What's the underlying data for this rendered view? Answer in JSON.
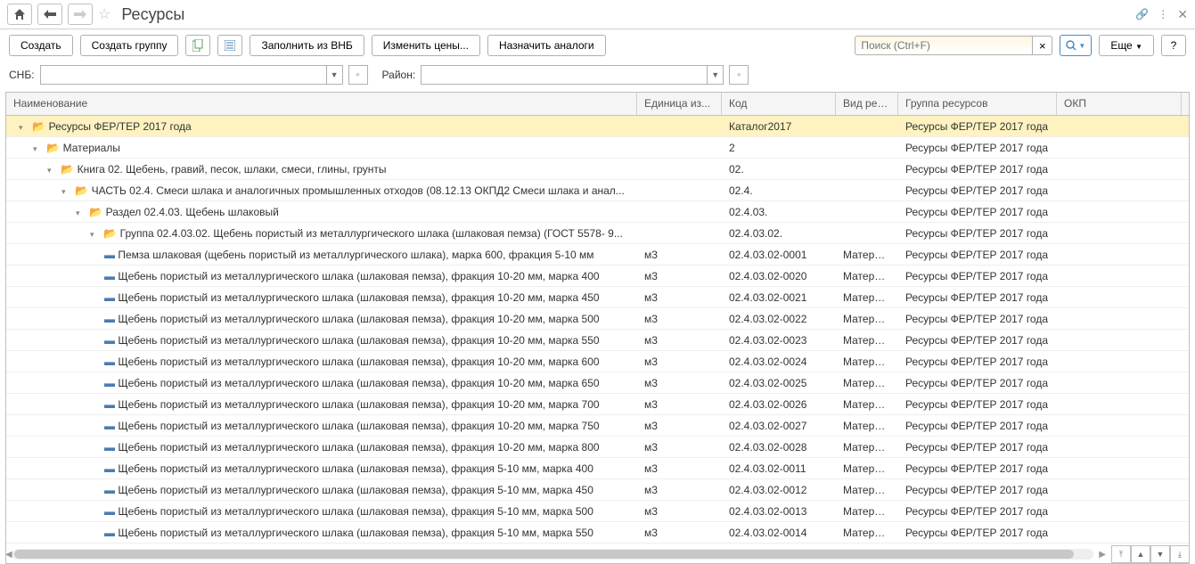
{
  "header": {
    "title": "Ресурсы"
  },
  "toolbar": {
    "create": "Создать",
    "create_group": "Создать группу",
    "fill": "Заполнить из ВНБ",
    "change": "Изменить цены...",
    "analogs": "Назначить аналоги",
    "search_placeholder": "Поиск (Ctrl+F)",
    "more": "Еще"
  },
  "filters": {
    "snb_label": "СНБ:",
    "region_label": "Район:"
  },
  "columns": {
    "name": "Наименование",
    "unit": "Единица из...",
    "code": "Код",
    "type": "Вид ресу...",
    "group": "Группа ресурсов",
    "okp": "ОКП"
  },
  "rows": [
    {
      "level": 0,
      "folder": true,
      "expanded": true,
      "selected": true,
      "name": "Ресурсы ФЕР/ТЕР 2017 года",
      "unit": "",
      "code": "Каталог2017",
      "type": "",
      "group": "Ресурсы ФЕР/ТЕР 2017 года"
    },
    {
      "level": 1,
      "folder": true,
      "expanded": true,
      "name": "Материалы",
      "unit": "",
      "code": "2",
      "type": "",
      "group": "Ресурсы ФЕР/ТЕР 2017 года"
    },
    {
      "level": 2,
      "folder": true,
      "expanded": true,
      "name": "Книга 02. Щебень, гравий, песок, шлаки, смеси, глины, грунты",
      "unit": "",
      "code": "02.",
      "type": "",
      "group": "Ресурсы ФЕР/ТЕР 2017 года"
    },
    {
      "level": 3,
      "folder": true,
      "expanded": true,
      "name": "ЧАСТЬ 02.4. Смеси шлака и аналогичных промышленных отходов (08.12.13 ОКПД2 Смеси шлака и анал...",
      "unit": "",
      "code": "02.4.",
      "type": "",
      "group": "Ресурсы ФЕР/ТЕР 2017 года"
    },
    {
      "level": 4,
      "folder": true,
      "expanded": true,
      "name": "Раздел 02.4.03. Щебень шлаковый",
      "unit": "",
      "code": "02.4.03.",
      "type": "",
      "group": "Ресурсы ФЕР/ТЕР 2017 года"
    },
    {
      "level": 5,
      "folder": true,
      "expanded": true,
      "name": "Группа 02.4.03.02. Щебень пористый из металлургического шлака (шлаковая пемза) (ГОСТ 5578- 9...",
      "unit": "",
      "code": "02.4.03.02.",
      "type": "",
      "group": "Ресурсы ФЕР/ТЕР 2017 года"
    },
    {
      "level": 6,
      "folder": false,
      "name": "Пемза шлаковая (щебень пористый из металлургического шлака), марка 600, фракция 5-10 мм",
      "unit": "м3",
      "code": "02.4.03.02-0001",
      "type": "Материа...",
      "group": "Ресурсы ФЕР/ТЕР 2017 года"
    },
    {
      "level": 6,
      "folder": false,
      "name": "Щебень пористый из металлургического шлака (шлаковая пемза), фракция 10-20 мм, марка 400",
      "unit": "м3",
      "code": "02.4.03.02-0020",
      "type": "Материа...",
      "group": "Ресурсы ФЕР/ТЕР 2017 года"
    },
    {
      "level": 6,
      "folder": false,
      "name": "Щебень пористый из металлургического шлака (шлаковая пемза), фракция 10-20 мм, марка 450",
      "unit": "м3",
      "code": "02.4.03.02-0021",
      "type": "Материа...",
      "group": "Ресурсы ФЕР/ТЕР 2017 года"
    },
    {
      "level": 6,
      "folder": false,
      "name": "Щебень пористый из металлургического шлака (шлаковая пемза), фракция 10-20 мм, марка 500",
      "unit": "м3",
      "code": "02.4.03.02-0022",
      "type": "Материа...",
      "group": "Ресурсы ФЕР/ТЕР 2017 года"
    },
    {
      "level": 6,
      "folder": false,
      "name": "Щебень пористый из металлургического шлака (шлаковая пемза), фракция 10-20 мм, марка 550",
      "unit": "м3",
      "code": "02.4.03.02-0023",
      "type": "Материа...",
      "group": "Ресурсы ФЕР/ТЕР 2017 года"
    },
    {
      "level": 6,
      "folder": false,
      "name": "Щебень пористый из металлургического шлака (шлаковая пемза), фракция 10-20 мм, марка 600",
      "unit": "м3",
      "code": "02.4.03.02-0024",
      "type": "Материа...",
      "group": "Ресурсы ФЕР/ТЕР 2017 года"
    },
    {
      "level": 6,
      "folder": false,
      "name": "Щебень пористый из металлургического шлака (шлаковая пемза), фракция 10-20 мм, марка 650",
      "unit": "м3",
      "code": "02.4.03.02-0025",
      "type": "Материа...",
      "group": "Ресурсы ФЕР/ТЕР 2017 года"
    },
    {
      "level": 6,
      "folder": false,
      "name": "Щебень пористый из металлургического шлака (шлаковая пемза), фракция 10-20 мм, марка 700",
      "unit": "м3",
      "code": "02.4.03.02-0026",
      "type": "Материа...",
      "group": "Ресурсы ФЕР/ТЕР 2017 года"
    },
    {
      "level": 6,
      "folder": false,
      "name": "Щебень пористый из металлургического шлака (шлаковая пемза), фракция 10-20 мм, марка 750",
      "unit": "м3",
      "code": "02.4.03.02-0027",
      "type": "Материа...",
      "group": "Ресурсы ФЕР/ТЕР 2017 года"
    },
    {
      "level": 6,
      "folder": false,
      "name": "Щебень пористый из металлургического шлака (шлаковая пемза), фракция 10-20 мм, марка 800",
      "unit": "м3",
      "code": "02.4.03.02-0028",
      "type": "Материа...",
      "group": "Ресурсы ФЕР/ТЕР 2017 года"
    },
    {
      "level": 6,
      "folder": false,
      "name": "Щебень пористый из металлургического шлака (шлаковая пемза), фракция 5-10 мм, марка 400",
      "unit": "м3",
      "code": "02.4.03.02-0011",
      "type": "Материа...",
      "group": "Ресурсы ФЕР/ТЕР 2017 года"
    },
    {
      "level": 6,
      "folder": false,
      "name": "Щебень пористый из металлургического шлака (шлаковая пемза), фракция 5-10 мм, марка 450",
      "unit": "м3",
      "code": "02.4.03.02-0012",
      "type": "Материа...",
      "group": "Ресурсы ФЕР/ТЕР 2017 года"
    },
    {
      "level": 6,
      "folder": false,
      "name": "Щебень пористый из металлургического шлака (шлаковая пемза), фракция 5-10 мм, марка 500",
      "unit": "м3",
      "code": "02.4.03.02-0013",
      "type": "Материа...",
      "group": "Ресурсы ФЕР/ТЕР 2017 года"
    },
    {
      "level": 6,
      "folder": false,
      "name": "Щебень пористый из металлургического шлака (шлаковая пемза), фракция 5-10 мм, марка 550",
      "unit": "м3",
      "code": "02.4.03.02-0014",
      "type": "Материа...",
      "group": "Ресурсы ФЕР/ТЕР 2017 года"
    }
  ]
}
